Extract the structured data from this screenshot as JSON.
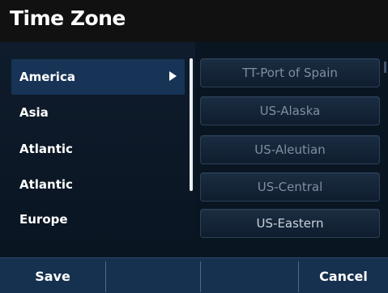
{
  "title": "Time Zone",
  "regions": [
    {
      "label": "America",
      "selected": true
    },
    {
      "label": "Asia",
      "selected": false
    },
    {
      "label": "Atlantic",
      "selected": false
    },
    {
      "label": "Atlantic",
      "selected": false
    },
    {
      "label": "Europe",
      "selected": false
    }
  ],
  "zones": [
    {
      "label": "TT-Port of Spain"
    },
    {
      "label": "US-Alaska"
    },
    {
      "label": "US-Aleutian"
    },
    {
      "label": "US-Central"
    },
    {
      "label": "US-Eastern"
    }
  ],
  "softkeys": {
    "save": "Save",
    "cancel": "Cancel"
  },
  "colors": {
    "background": "#0a1522",
    "selected_row": "#173457",
    "softkey_bar": "#16314f",
    "dim_text": "#7f8ea0"
  }
}
